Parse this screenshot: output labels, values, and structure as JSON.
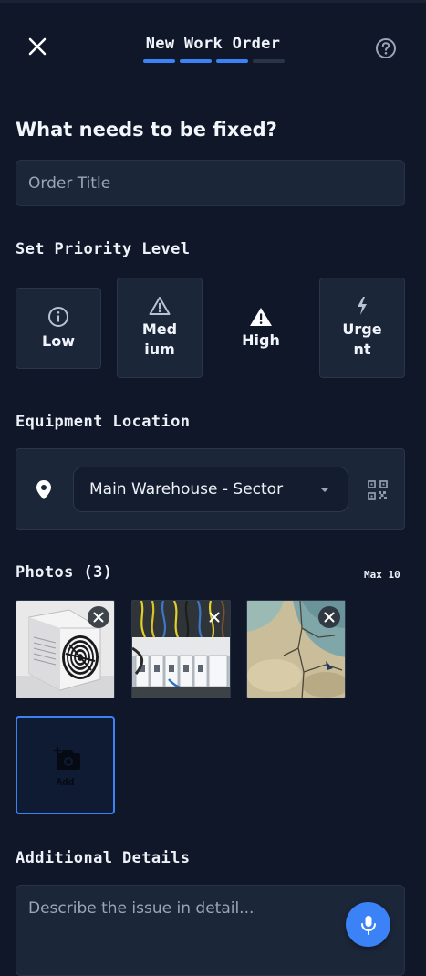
{
  "header": {
    "title": "New Work Order",
    "progress": {
      "completed_steps": 3,
      "total_steps": 4
    }
  },
  "question": {
    "title": "What needs to be fixed?"
  },
  "order_title": {
    "placeholder": "Order Title",
    "value": ""
  },
  "priority": {
    "label": "Set Priority Level",
    "selected": "High",
    "options": [
      {
        "label": "Low",
        "icon": "info-circle-icon"
      },
      {
        "label": "Med\nium",
        "icon": "warning-outline-icon"
      },
      {
        "label": "High",
        "icon": "warning-filled-icon"
      },
      {
        "label": "Urge\nnt",
        "icon": "bolt-icon"
      }
    ]
  },
  "location": {
    "label": "Equipment Location",
    "selected": "Main Warehouse - Sector",
    "icons": [
      "map-pin-icon",
      "qr-code-icon"
    ]
  },
  "photos": {
    "label": "Photos (3)",
    "max_label": "Max 10",
    "items": [
      {
        "subject": "outdoor air conditioning unit"
      },
      {
        "subject": "electrical panel with wiring"
      },
      {
        "subject": "cracked concrete floor"
      }
    ],
    "add_label": "Add"
  },
  "details": {
    "label": "Additional Details",
    "placeholder": "Describe the issue in detail..."
  },
  "colors": {
    "background": "#0f1729",
    "card": "#1c2639",
    "accent": "#3b82f6"
  }
}
